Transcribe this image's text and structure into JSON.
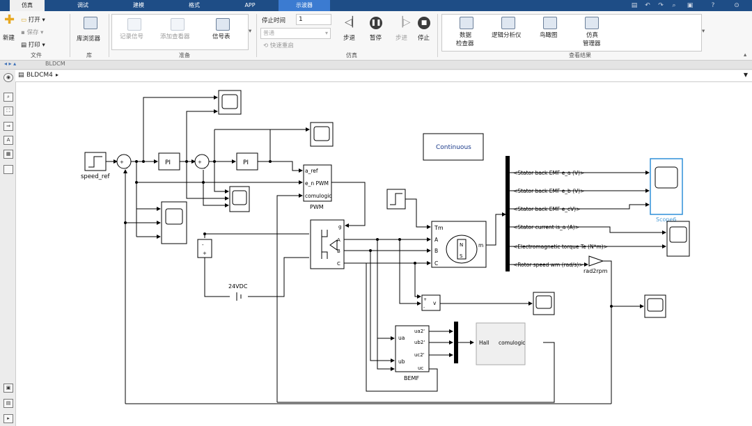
{
  "tabs": [
    "仿真",
    "调试",
    "建模",
    "格式",
    "APP",
    "示波器"
  ],
  "ribbon": {
    "file": {
      "new": "新建",
      "open": "打开",
      "save": "保存",
      "print": "打印",
      "group": "文件"
    },
    "library": {
      "browser": "库浏览器",
      "group": "库"
    },
    "prepare": {
      "log_signals": "记录信号",
      "add_viewer": "添加查看器",
      "signal_table": "信号表",
      "group": "准备"
    },
    "simulate": {
      "stop_time_label": "停止时间",
      "stop_time_value": "1",
      "mode": "普通",
      "fast_restart": "快速重启",
      "step_back": "步退",
      "pause": "暂停",
      "step_forward": "步进",
      "stop": "停止",
      "group": "仿真"
    },
    "review": {
      "data_inspector_1": "数据",
      "data_inspector_2": "检查器",
      "logic_analyzer": "逻辑分析仪",
      "birds_eye": "鸟瞰图",
      "sim_manager_1": "仿真",
      "sim_manager_2": "管理器",
      "group": "查看结果"
    }
  },
  "address": {
    "tab_path": "BLDCM",
    "model_path": "BLDCM4"
  },
  "diagram": {
    "speed_ref": "speed_ref",
    "pi1": "PI",
    "pi2": "PI",
    "pwm": {
      "in1": "a_ref",
      "in2": "e_n PWM",
      "in3": "comulogic",
      "name": "PWM"
    },
    "inverter_ports": {
      "g": "g",
      "a": "A",
      "b": "B",
      "c": "C"
    },
    "dc_source": "24VDC",
    "continuous": "Continuous",
    "motor": {
      "tm": "Tm",
      "a": "A",
      "b": "B",
      "c": "C",
      "m": "m",
      "n": "N",
      "s": "S"
    },
    "voltmeter": "v",
    "bus_signals": [
      "<Stator back EMF e_a (V)>",
      "<Stator back EMF e_b (V)>",
      "<Stator back EMF e_cV)>",
      "<Stator current is_a (A)>",
      "<Electromagnetic torque Te (N*m)>",
      "<Rotor speed wm (rad/s)>"
    ],
    "gain": "rad2rpm",
    "scope6": "Scope6",
    "bemf": {
      "in1": "ua",
      "in2": "ub",
      "out1": "ua2'",
      "out2": "ub2'",
      "out3": "uc2'",
      "out4": "uc",
      "name": "BEMF"
    },
    "hall": {
      "in": "Hall",
      "out": "comulogic"
    }
  },
  "colors": {
    "tabbar": "#1e4d86",
    "scope_tab": "#3b7bd1",
    "selected": "#2f8fd8",
    "scope_label": "#4a9cd8"
  }
}
